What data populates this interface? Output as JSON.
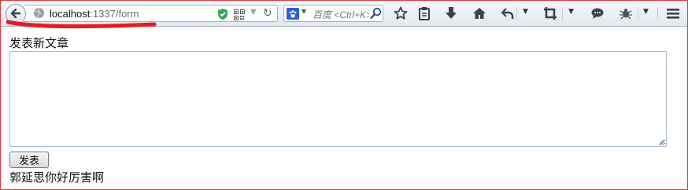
{
  "browser": {
    "url_host": "localhost",
    "url_path": ":1337/form",
    "search_placeholder": "百度 <Ctrl+K>",
    "icons": {
      "back": "back-arrow-icon",
      "site": "globe-icon",
      "shield": "shield-check-icon",
      "qr": "qr-code-icon",
      "reload": "reload-icon",
      "search_engine": "baidu-paw-icon",
      "search": "search-icon",
      "bookmark": "star-icon",
      "library": "clipboard-icon",
      "download": "download-icon",
      "home": "home-icon",
      "undo": "undo-icon",
      "crop": "crop-icon",
      "chat": "chat-bubble-icon",
      "bug": "bug-icon",
      "menu": "hamburger-menu-icon"
    },
    "accent": "#e0393e"
  },
  "form": {
    "heading": "发表新文章",
    "textarea_value": "",
    "submit_label": "发表"
  },
  "result": {
    "text": "郭延思你好厉害啊"
  }
}
